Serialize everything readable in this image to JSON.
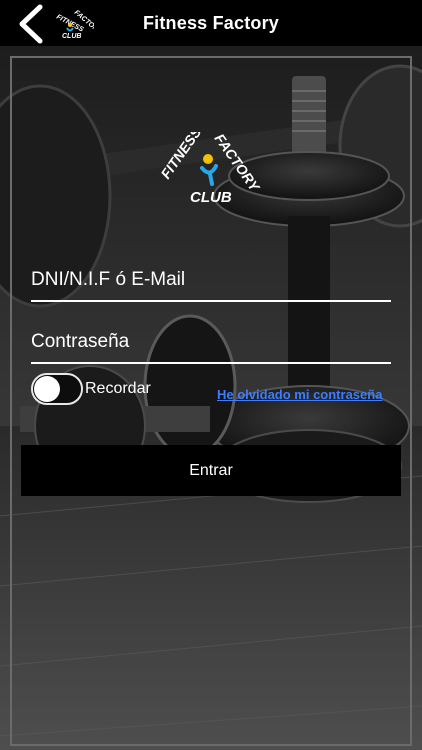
{
  "header": {
    "title": "Fitness Factory",
    "back_icon": "chevron-left-icon",
    "logo": {
      "line1": "FITNESS",
      "line2": "FACTORY",
      "line3": "CLUB"
    }
  },
  "brand_logo": {
    "line1": "FITNESS",
    "line2": "FACTORY",
    "line3": "CLUB",
    "accent_blue": "#2aa7e8",
    "accent_yellow": "#f2c200"
  },
  "form": {
    "user_placeholder": "DNI/N.I.F ó E-Mail",
    "password_placeholder": "Contraseña",
    "remember_label": "Recordar",
    "remember_checked": false,
    "forgot_link": "He olvidado mi contraseña",
    "submit_label": "Entrar"
  },
  "colors": {
    "link": "#3d7dff",
    "button_bg": "#000000"
  }
}
